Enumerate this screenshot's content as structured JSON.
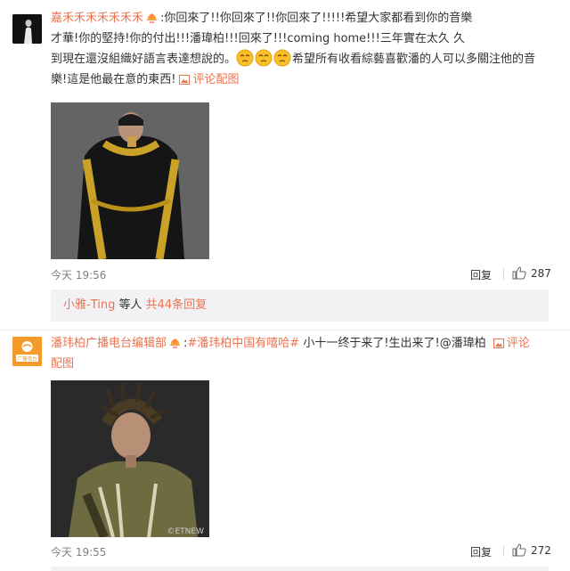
{
  "comments": [
    {
      "username": "嘉禾禾禾禾禾禾禾",
      "text_lines": [
        ":你回來了!!你回來了!!你回來了!!!!!希望大家都看到你的音樂",
        "才華!你的堅持!你的付出!!!潘瑋柏!!!回來了!!!coming home!!!三年實在太久 久",
        "到現在還沒組織好語言表達想說的。",
        "希望所有收看綜藝喜歡潘的人可以多關注他的音",
        "樂!這是他最在意的東西!"
      ],
      "view_pic_label": "评论配图",
      "time": "今天 19:56",
      "reply_label": "回复",
      "likes": "287",
      "thread": {
        "user": "小雅-Ting",
        "mid": "等人",
        "count": "共44条回复"
      }
    },
    {
      "username": "潘玮柏广播电台编辑部",
      "avatar_text": "广播电台",
      "topic": "#潘玮柏中国有嘻哈#",
      "text_lines": [
        " 小十一终于来了!生出来了!@潘瑋柏 "
      ],
      "view_pic_label": "评论",
      "view_pic_label2": "配图",
      "photo_watermark": "©ETNEW",
      "time": "今天 19:55",
      "reply_label": "回复",
      "likes": "272"
    }
  ],
  "colors": {
    "accent": "#eb7350",
    "muted": "#808080",
    "thread_bg": "#f2f2f5"
  }
}
